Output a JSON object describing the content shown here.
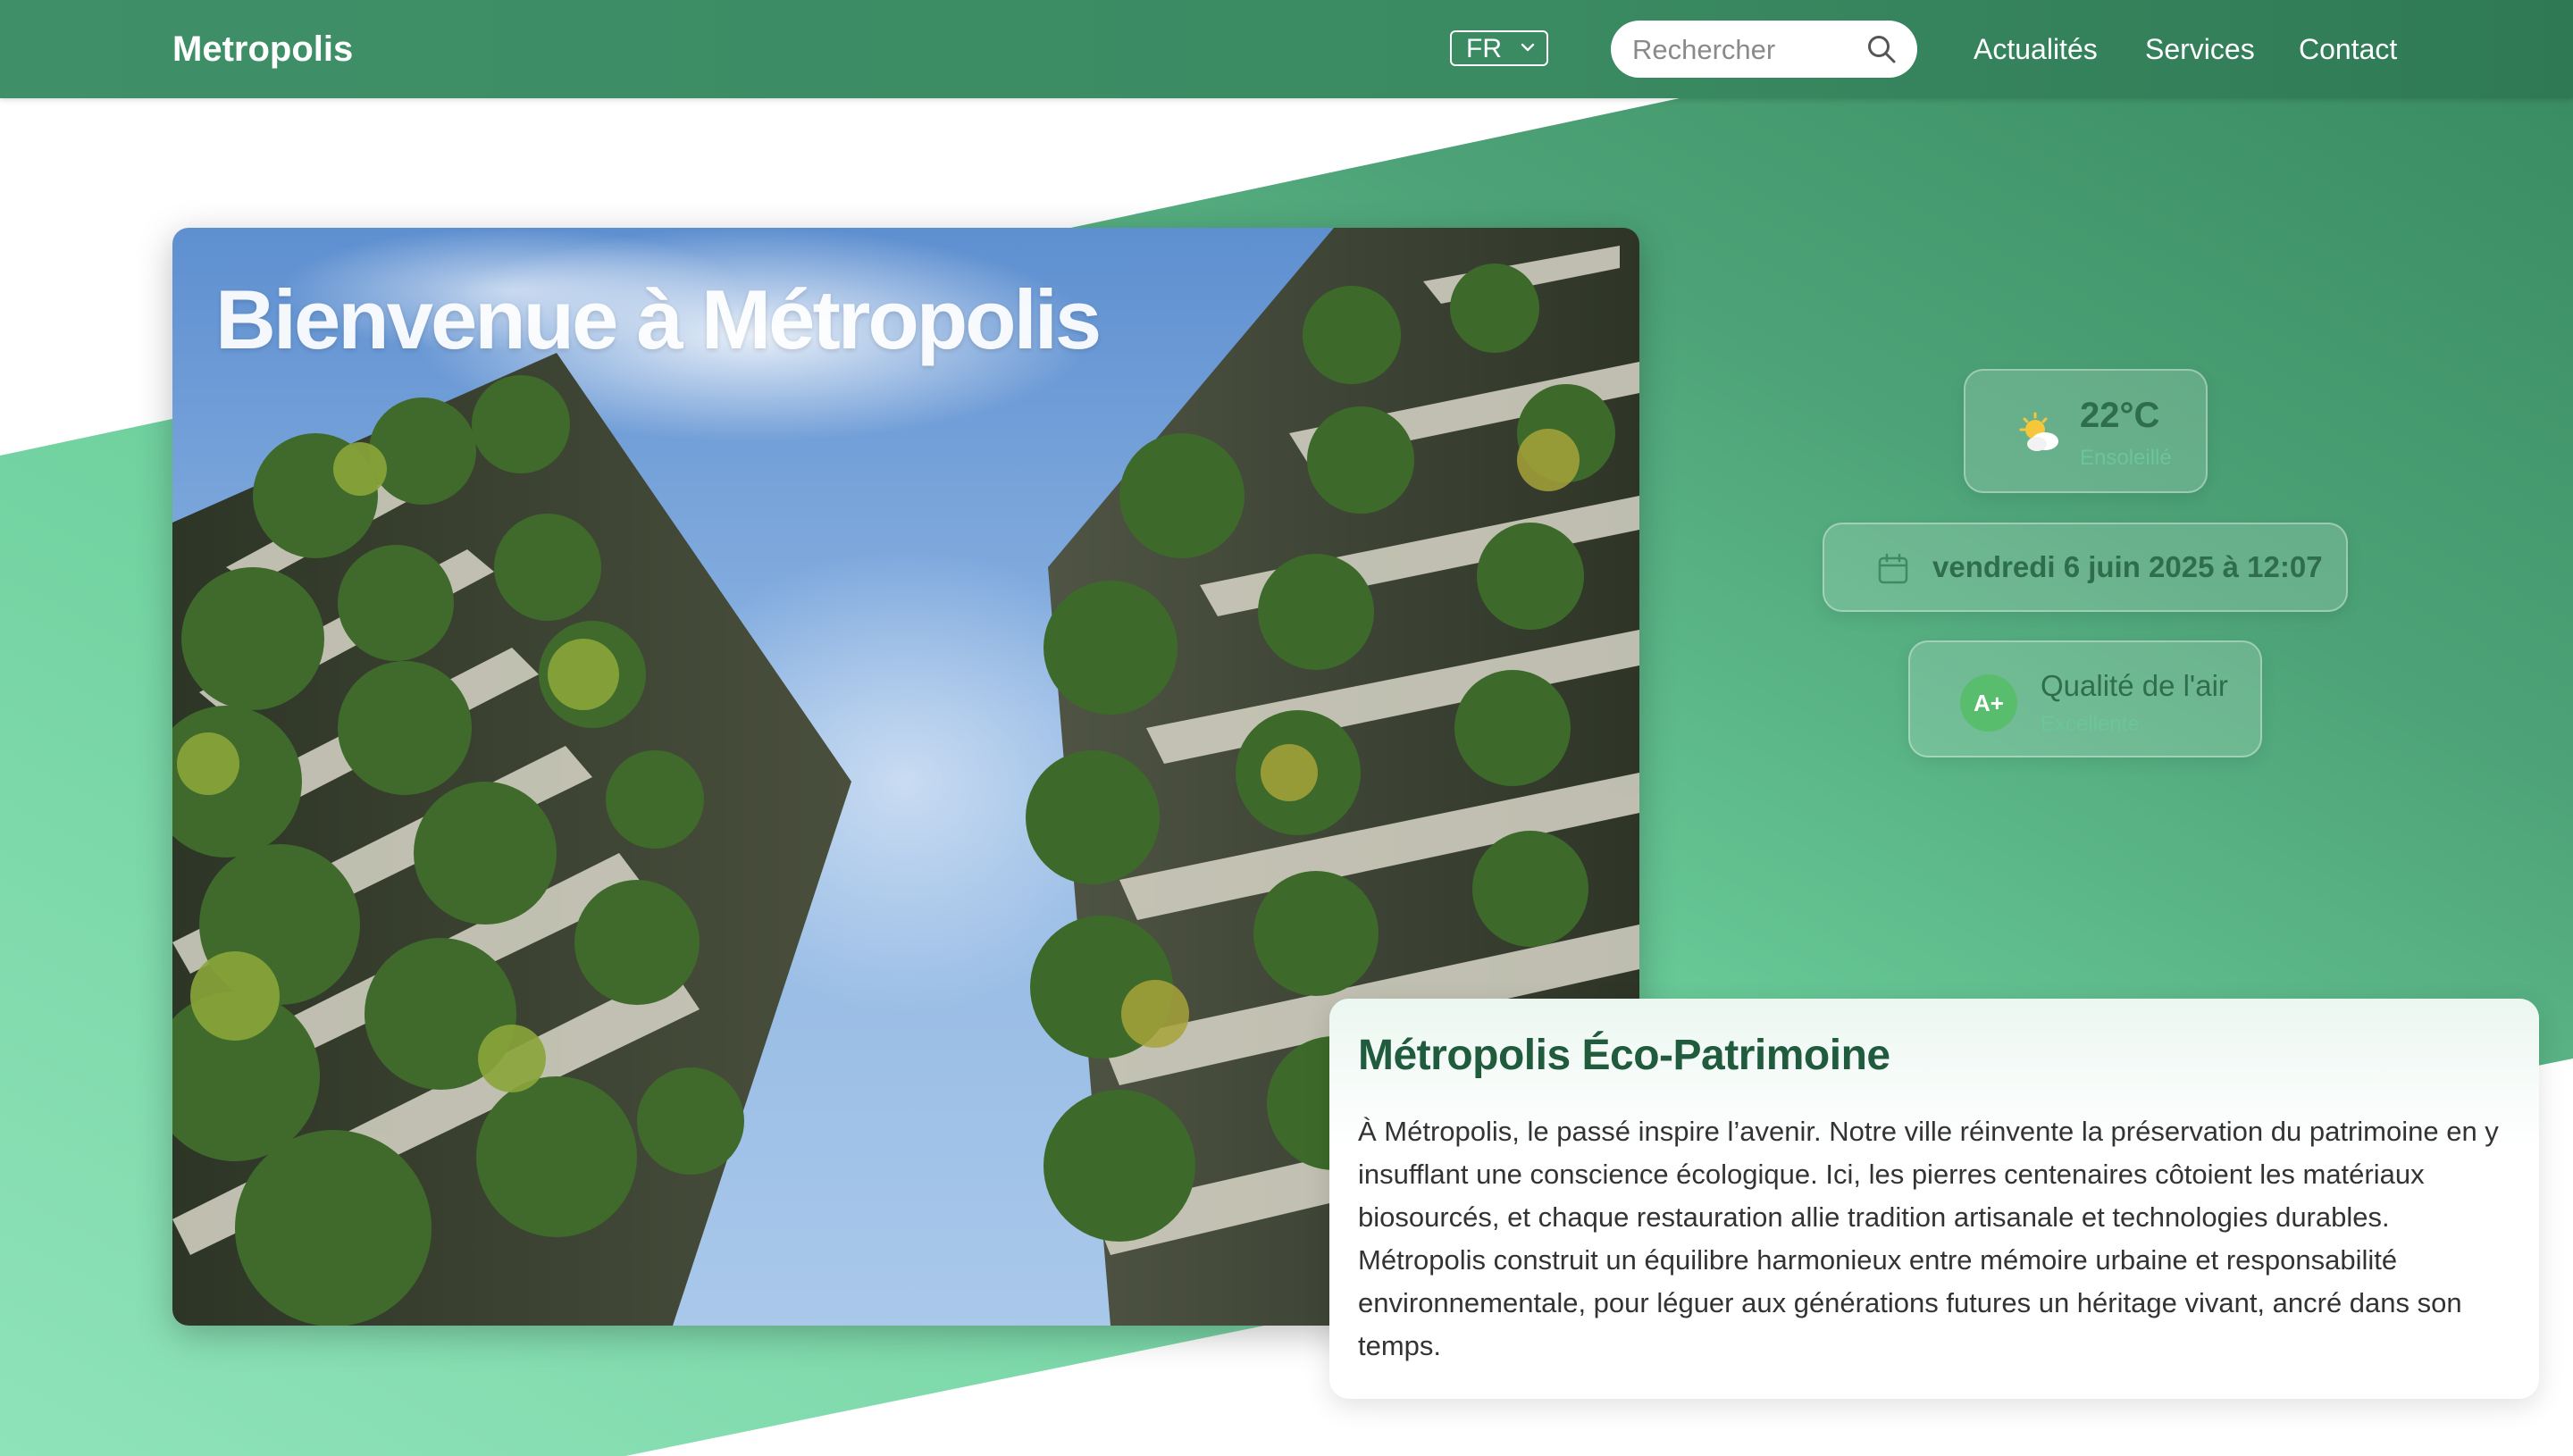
{
  "header": {
    "brand": "Metropolis",
    "language": "FR",
    "search_placeholder": "Rechercher",
    "nav": [
      "Actualités",
      "Services",
      "Contact"
    ]
  },
  "hero": {
    "title": "Bienvenue à Métropolis",
    "image_alt": "vertical-forest-towers"
  },
  "widgets": {
    "weather": {
      "temperature": "22°C",
      "condition": "Ensoleillé",
      "icon": "sun-cloud-icon"
    },
    "date": {
      "text": "vendredi 6 juin 2025 à 12:07",
      "icon": "calendar-icon"
    },
    "air": {
      "badge": "A+",
      "label": "Qualité de l'air",
      "value": "Excellente"
    }
  },
  "article": {
    "title": "Métropolis Éco-Patrimoine",
    "body": "À Métropolis, le passé inspire l’avenir. Notre ville réinvente la préservation du patrimoine en y insufflant une conscience écologique. Ici, les pierres centenaires côtoient les matériaux biosourcés, et chaque restauration allie tradition artisanale et technologies durables. Métropolis construit un équilibre harmonieux entre mémoire urbaine et responsabilité environnementale, pour léguer aux générations futures un héritage vivant, ancré dans son temps."
  },
  "colors": {
    "nav_green": "#3a8a62",
    "band_light": "#86dfb1",
    "band_dark": "#3b9066",
    "title_green": "#1f5b3c",
    "badge_green": "#59bd6e"
  }
}
